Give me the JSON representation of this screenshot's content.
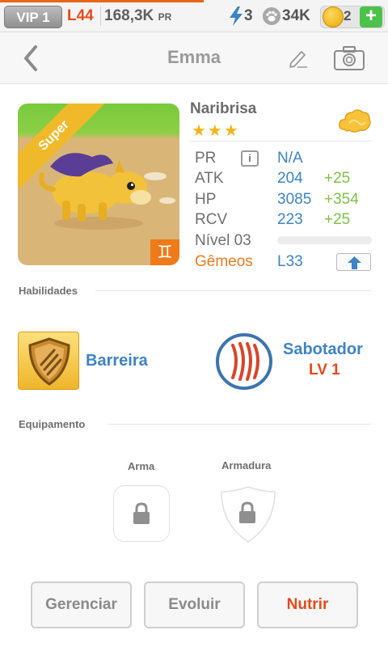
{
  "status_bar": {
    "vip": "VIP 1",
    "level": "L44",
    "power": "168,3K",
    "power_unit": "PR",
    "energy": "3",
    "food": "34K",
    "coins": "2",
    "add_label": "+"
  },
  "header": {
    "title": "Emma"
  },
  "pet": {
    "rarity": "Super",
    "name": "Naribrisa",
    "stars": "★★★",
    "zodiac_symbol": "♊",
    "stats": {
      "pr_label": "PR",
      "pr_value": "N/A",
      "atk_label": "ATK",
      "atk_value": "204",
      "atk_bonus": "+25",
      "hp_label": "HP",
      "hp_value": "3085",
      "hp_bonus": "+354",
      "rcv_label": "RCV",
      "rcv_value": "223",
      "rcv_bonus": "+25",
      "level_label": "Nível 03",
      "level_progress": 0,
      "sign_label": "Gêmeos",
      "sign_level": "L33"
    }
  },
  "abilities": {
    "section_label": "Habilidades",
    "items": [
      {
        "name": "Barreira",
        "icon": "shield-claw-icon"
      },
      {
        "name": "Sabotador",
        "level": "LV 1",
        "icon": "claw-marks-icon"
      }
    ]
  },
  "equipment": {
    "section_label": "Equipamento",
    "weapon_label": "Arma",
    "armor_label": "Armadura"
  },
  "actions": {
    "manage": "Gerenciar",
    "evolve": "Evoluir",
    "feed": "Nutrir"
  },
  "colors": {
    "accent_orange": "#e64a19",
    "stat_blue": "#3d84c4",
    "bonus_green": "#7dc243",
    "star_gold": "#f2b61c"
  }
}
